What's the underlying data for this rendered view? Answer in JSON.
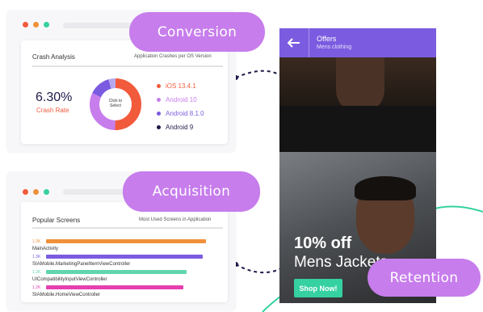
{
  "colors": {
    "accent_purple": "#c77dec",
    "phone_header": "#7b5ce0",
    "teal": "#35d1a0",
    "red": "#f25a3c",
    "orange": "#f0913a"
  },
  "pills": {
    "conversion": "Conversion",
    "acquisition": "Acquisition",
    "retention": "Retention"
  },
  "crash_card": {
    "title": "Crash Analysis",
    "subtitle": "Application Crashes per OS Version",
    "rate_value": "6.30%",
    "rate_label": "Crash Rate",
    "donut_center": "Click to\nSelect",
    "legend": [
      {
        "label": "iOS 13.4.1",
        "color": "#f25a3c"
      },
      {
        "label": "Android 10",
        "color": "#c77dec"
      },
      {
        "label": "Android 8.1.0",
        "color": "#7b5ce0"
      },
      {
        "label": "Android 9",
        "color": "#1d1b4a"
      }
    ],
    "donut_icon": "donut-chart-icon"
  },
  "screens_card": {
    "title": "Popular Screens",
    "subtitle": "Most Used Screens in Application",
    "rows": [
      {
        "count": "1.3K",
        "label": "MainActivity",
        "color": "#f0913a",
        "fraction": 1.0
      },
      {
        "count": "1.3K",
        "label": "SIAMobile.MarketingPanelItemViewController",
        "color": "#7b5ce0",
        "fraction": 0.98
      },
      {
        "count": "1.2K",
        "label": "UICompatibilityInputViewController",
        "color": "#5fd6b0",
        "fraction": 0.88
      },
      {
        "count": "1.2K",
        "label": "SIAMobile.HomeViewController",
        "color": "#e640b0",
        "fraction": 0.86
      }
    ]
  },
  "phone": {
    "back_icon": "arrow-left-icon",
    "header_title": "Offers",
    "header_subtitle": "Mens clothing",
    "promo_headline": "10% off",
    "promo_subline": "Mens Jackets",
    "cta_label": "Shop Now!"
  }
}
